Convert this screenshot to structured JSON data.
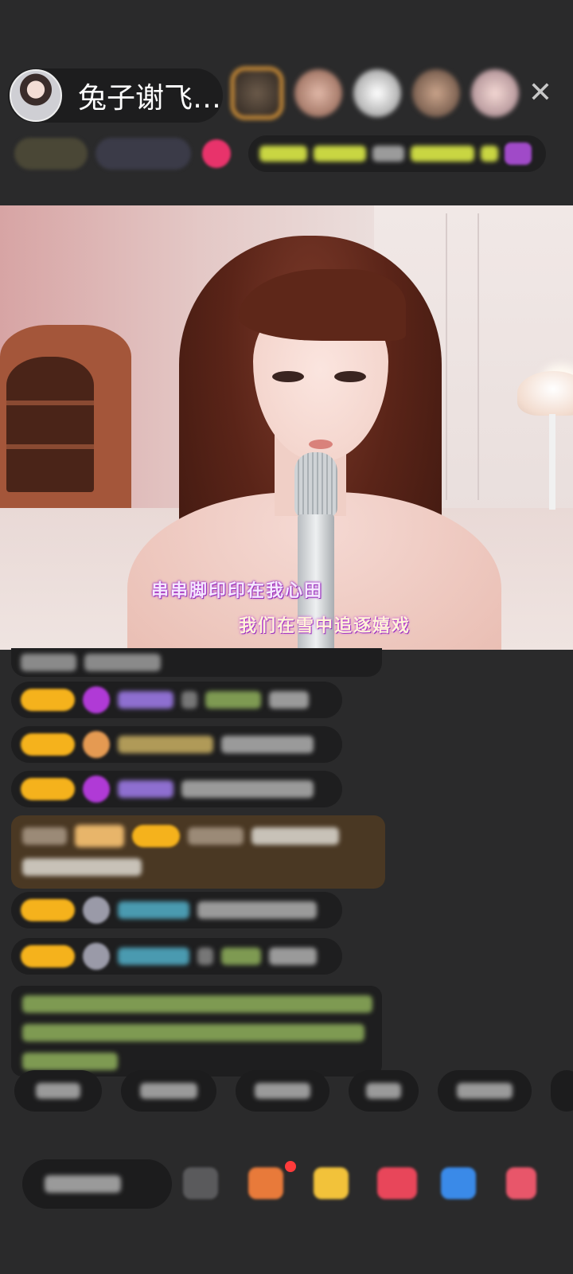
{
  "header": {
    "host_name": "兔子谢飞…",
    "close_label": "✕"
  },
  "video": {
    "lyric_line_1": "串串脚印印在我心田",
    "lyric_line_2": "我们在雪中追逐嬉戏"
  },
  "colors": {
    "background": "#2a2a2b",
    "badge_gold": "#f5b21c",
    "lyric_glow": "#b43ad0",
    "notification_dot": "#ff3b3b"
  },
  "icons": [
    "close-icon",
    "gift-box-icon",
    "treasure-icon",
    "heart-gift-icon",
    "game-controller-icon",
    "more-apps-icon",
    "diamond-icon"
  ]
}
